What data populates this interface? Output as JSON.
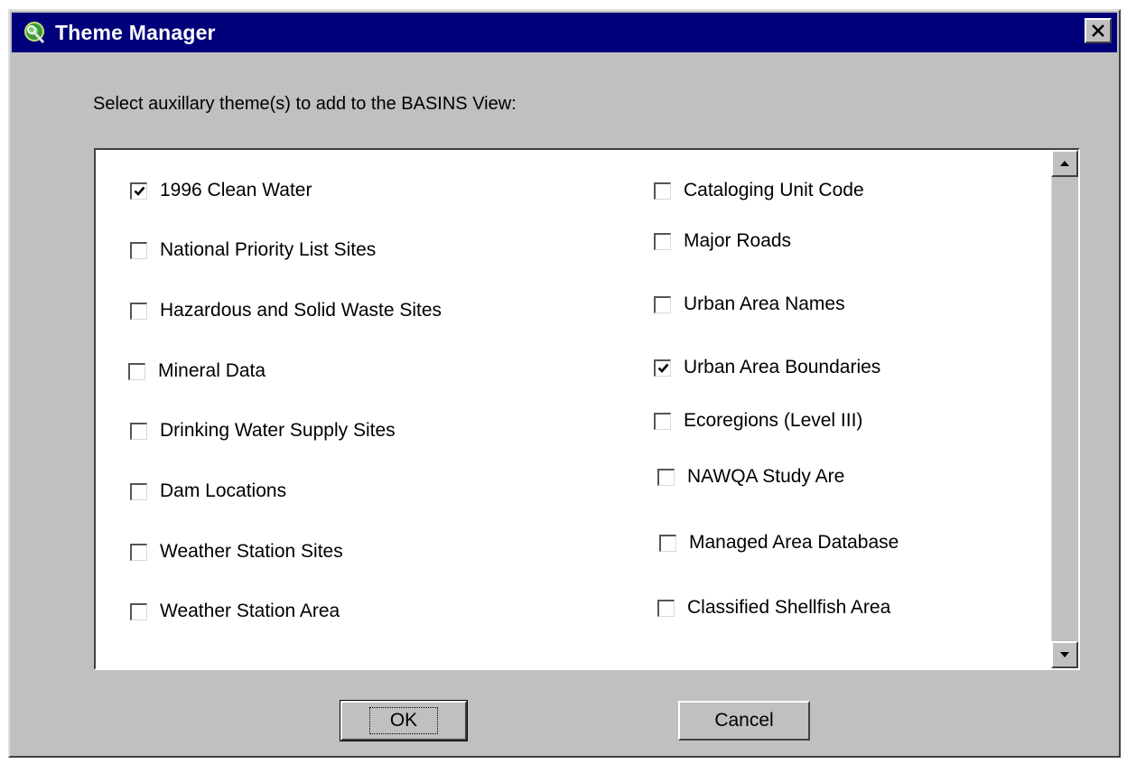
{
  "window": {
    "title": "Theme Manager",
    "icon": "theme-manager-icon",
    "close_icon": "close-icon"
  },
  "prompt": "Select auxillary theme(s) to add to the BASINS View:",
  "themes_left": [
    {
      "label": "1996 Clean Water",
      "checked": true
    },
    {
      "label": "National Priority List Sites",
      "checked": false
    },
    {
      "label": "Hazardous and Solid Waste Sites",
      "checked": false
    },
    {
      "label": "Mineral Data",
      "checked": false
    },
    {
      "label": "Drinking Water Supply Sites",
      "checked": false
    },
    {
      "label": "Dam Locations",
      "checked": false
    },
    {
      "label": "Weather Station Sites",
      "checked": false
    },
    {
      "label": "Weather Station Area",
      "checked": false
    }
  ],
  "themes_right": [
    {
      "label": "Cataloging Unit Code",
      "checked": false
    },
    {
      "label": "Major Roads",
      "checked": false
    },
    {
      "label": "Urban Area Names",
      "checked": false
    },
    {
      "label": "Urban Area Boundaries",
      "checked": true
    },
    {
      "label": "Ecoregions (Level III)",
      "checked": false
    },
    {
      "label": "NAWQA Study Are",
      "checked": false
    },
    {
      "label": "Managed Area Database",
      "checked": false
    },
    {
      "label": "Classified Shellfish Area",
      "checked": false
    }
  ],
  "buttons": {
    "ok": "OK",
    "cancel": "Cancel"
  },
  "colors": {
    "titlebar": "#00007b",
    "face": "#c0c0c0"
  }
}
